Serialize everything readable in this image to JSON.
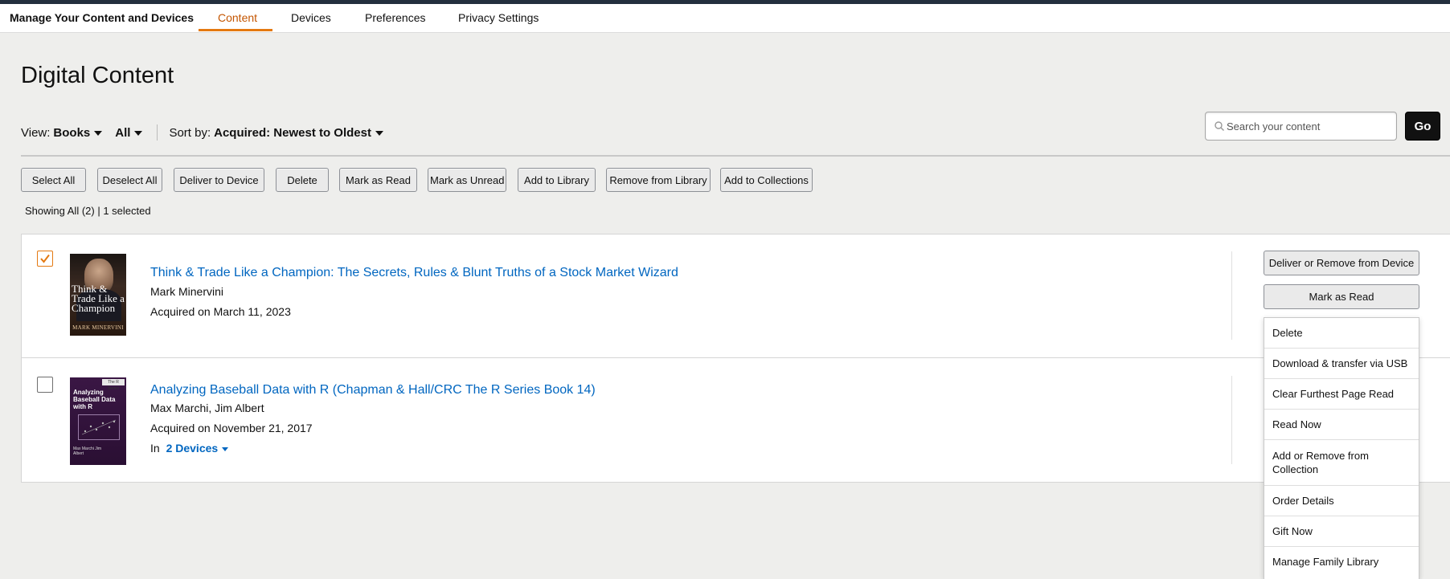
{
  "header": {
    "brand": "Manage Your Content and Devices",
    "tabs": [
      {
        "label": "Content",
        "active": true
      },
      {
        "label": "Devices"
      },
      {
        "label": "Preferences"
      },
      {
        "label": "Privacy Settings"
      }
    ]
  },
  "page_title": "Digital Content",
  "filters": {
    "view_label": "View:",
    "view_type": "Books",
    "view_scope": "All",
    "sort_label": "Sort by:",
    "sort_value": "Acquired: Newest to Oldest"
  },
  "search": {
    "placeholder": "Search your content",
    "go_label": "Go"
  },
  "actions": [
    "Select All",
    "Deselect All",
    "Deliver to Device",
    "Delete",
    "Mark as Read",
    "Mark as Unread",
    "Add to Library",
    "Remove from Library",
    "Add to Collections"
  ],
  "status": {
    "showing": "Showing All (2)",
    "selected": "| 1 selected"
  },
  "items": [
    {
      "title": "Think & Trade Like a Champion: The Secrets, Rules & Blunt Truths of a Stock Market Wizard",
      "author": "Mark Minervini",
      "acquired": "Acquired on March 11, 2023",
      "checked": true,
      "cover": {
        "title": "Think & Trade Like a Champion",
        "author": "MARK MINERVINI"
      }
    },
    {
      "title": "Analyzing Baseball Data with R (Chapman & Hall/CRC The R Series Book 14)",
      "author": "Max Marchi, Jim Albert",
      "acquired": "Acquired on November 21, 2017",
      "devices_prefix": "In",
      "devices_link": "2 Devices",
      "checked": false,
      "cover": {
        "title": "Analyzing Baseball Data with R",
        "badge": "The R Series",
        "author": "Max Marchi Jim Albert"
      }
    }
  ],
  "item_actions": {
    "deliver_remove": "Deliver or Remove from Device",
    "mark_read": "Mark as Read"
  },
  "menu": [
    "Delete",
    "Download & transfer via USB",
    "Clear Furthest Page Read",
    "Read Now",
    "Add or Remove from Collection",
    "Order Details",
    "Gift Now",
    "Manage Family Library"
  ],
  "colors": {
    "accent_orange": "#e47911",
    "active_tab": "#c45500",
    "link_blue": "#0066c0",
    "header_strip": "#232f3e"
  }
}
